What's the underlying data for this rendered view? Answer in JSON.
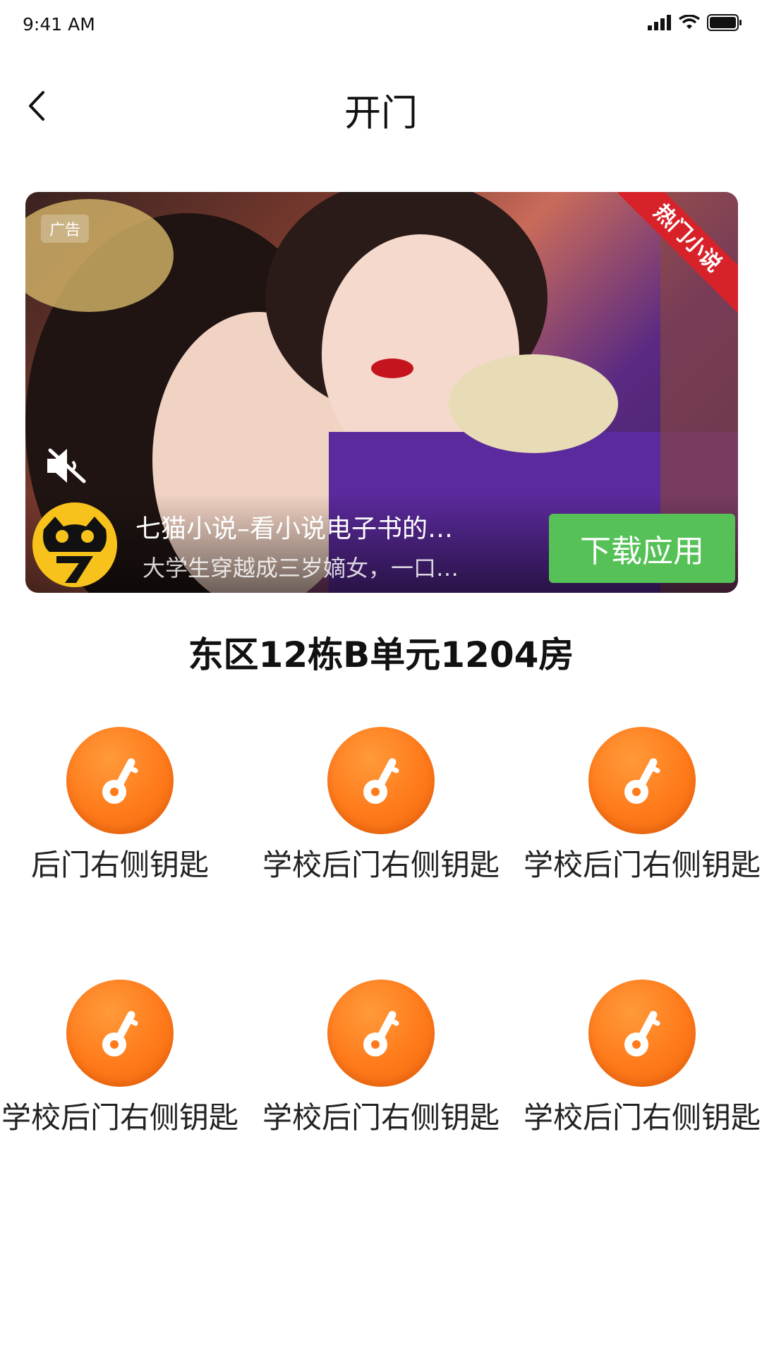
{
  "status_bar": {
    "time": "9:41 AM"
  },
  "nav": {
    "title": "开门"
  },
  "ad": {
    "tag": "广告",
    "ribbon": "热门小说",
    "title": "七猫小说–看小说电子书的…",
    "subtitle": "大学生穿越成三岁嫡女，一口…",
    "download_label": "下载应用"
  },
  "room": {
    "title": "东区12栋B单元1204房"
  },
  "keys": [
    {
      "label": "后门右侧钥匙"
    },
    {
      "label": "学校后门右侧钥匙"
    },
    {
      "label": "学校后门右侧钥匙"
    },
    {
      "label": "学校后门右侧钥匙"
    },
    {
      "label": "学校后门右侧钥匙"
    },
    {
      "label": "学校后门右侧钥匙"
    }
  ],
  "colors": {
    "key_orange": "#ff7a1a",
    "download_green": "#55c157",
    "ribbon_red": "#d8222a"
  }
}
